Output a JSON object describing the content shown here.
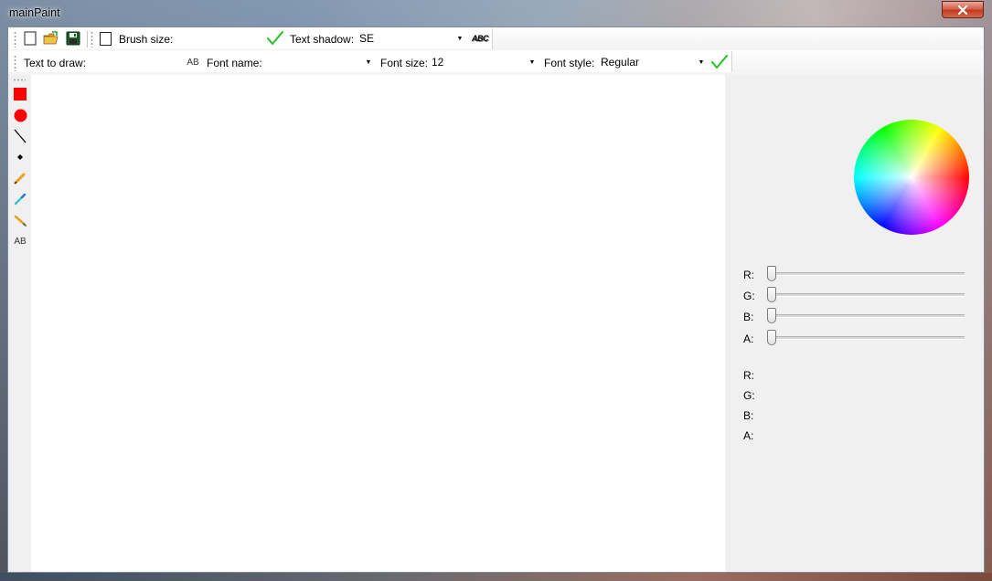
{
  "window": {
    "title": "mainPaint"
  },
  "toolbar1": {
    "new_tooltip": "",
    "brush_size_label": "Brush size:",
    "brush_size_value": "",
    "text_shadow_label": "Text shadow:",
    "text_shadow_value": "SE",
    "abc_label": "ABC"
  },
  "toolbar2": {
    "text_to_draw_label": "Text to draw:",
    "text_to_draw_value": "",
    "ab_label": "AB",
    "font_name_label": "Font name:",
    "font_name_value": "",
    "font_size_label": "Font size:",
    "font_size_value": "12",
    "font_style_label": "Font style:",
    "font_style_value": "Regular"
  },
  "tools": [
    {
      "name": "rectangle-tool",
      "icon": "filled-square-icon",
      "color": "#ff0000"
    },
    {
      "name": "ellipse-tool",
      "icon": "filled-circle-icon",
      "color": "#ff0000"
    },
    {
      "name": "line-tool",
      "icon": "diagonal-line-icon",
      "color": "#000000"
    },
    {
      "name": "point-tool",
      "icon": "dot-icon",
      "color": "#000000"
    },
    {
      "name": "pencil-tool",
      "icon": "pencil-icon",
      "color": "#e8a020"
    },
    {
      "name": "color-picker-tool",
      "icon": "eyedropper-icon",
      "color": "#40c0c0"
    },
    {
      "name": "brush-tool",
      "icon": "brush-icon",
      "color": "#e8a020"
    },
    {
      "name": "text-tool",
      "icon": "text-ab-icon",
      "label": "AB"
    }
  ],
  "color_panel": {
    "sliders": [
      {
        "label": "R:",
        "value": 0
      },
      {
        "label": "G:",
        "value": 0
      },
      {
        "label": "B:",
        "value": 0
      },
      {
        "label": "A:",
        "value": 0
      }
    ],
    "readouts": [
      {
        "label": "R:",
        "value": ""
      },
      {
        "label": "G:",
        "value": ""
      },
      {
        "label": "B:",
        "value": ""
      },
      {
        "label": "A:",
        "value": ""
      }
    ]
  },
  "colors": {
    "accent_check": "#22c022",
    "shape_red": "#ff0000",
    "canvas": "#ffffff",
    "panel": "#f0f0f0"
  }
}
